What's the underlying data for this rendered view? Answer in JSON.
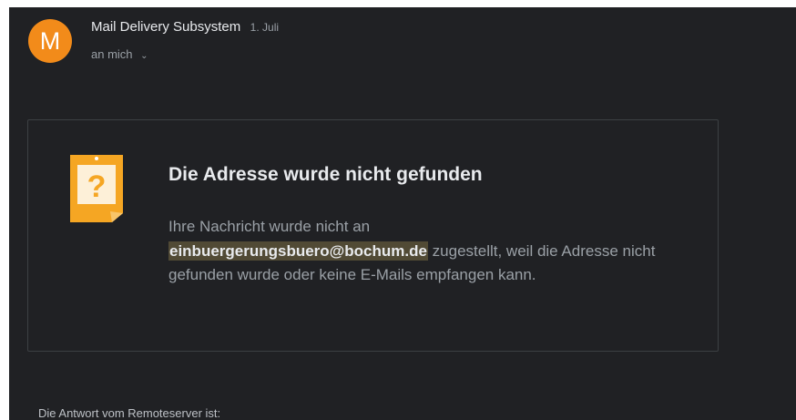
{
  "header": {
    "avatar_letter": "M",
    "sender_name": "Mail Delivery Subsystem",
    "date": "1. Juli",
    "recipient": "an mich",
    "recipient_chevron": "chevron-down-icon"
  },
  "bounce_card": {
    "icon": "question-note-icon",
    "title": "Die Adresse wurde nicht gefunden",
    "message_prefix": "Ihre Nachricht wurde nicht an",
    "address": "einbuergerungsbuero@bochum.de",
    "message_suffix": "zugestellt, weil die Adresse nicht gefunden wurde oder keine E-Mails empfangen kann."
  },
  "remote_server_text": "Die Antwort vom Remoteserver ist:",
  "colors": {
    "background": "#202124",
    "avatar": "#f28b1a",
    "icon": "#f5a623",
    "highlight": "#514a35"
  }
}
